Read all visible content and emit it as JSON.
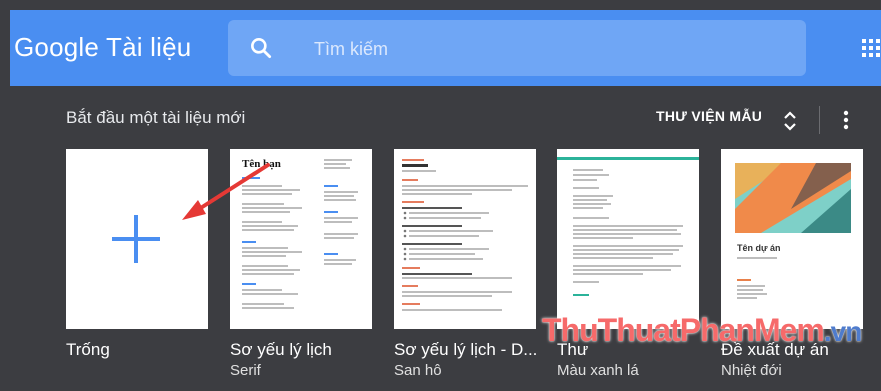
{
  "header": {
    "logo_text": "Google Tài liệu",
    "search": {
      "placeholder": "Tìm kiếm",
      "icon": "search-icon"
    },
    "apps_icon": "apps-grid-icon",
    "accent_color": "#4a8ef1"
  },
  "templates_section": {
    "title": "Bắt đầu một tài liệu mới",
    "gallery_label": "THƯ VIỆN MẪU",
    "templates": [
      {
        "name": "Trống",
        "subtitle": ""
      },
      {
        "name": "Sơ yếu lý lịch",
        "subtitle": "Serif"
      },
      {
        "name": "Sơ yếu lý lịch - D...",
        "subtitle": "San hô"
      },
      {
        "name": "Thư",
        "subtitle": "Màu xanh lá"
      },
      {
        "name": "Đề xuất dự án",
        "subtitle": "Nhiệt đới"
      }
    ]
  },
  "thumbnails": {
    "resume_serif_heading": "Tên bạn",
    "proposal_heading": "Tên dự án"
  },
  "watermark": {
    "main": "ThuThuatPhanMem",
    "suffix": ".vn"
  }
}
